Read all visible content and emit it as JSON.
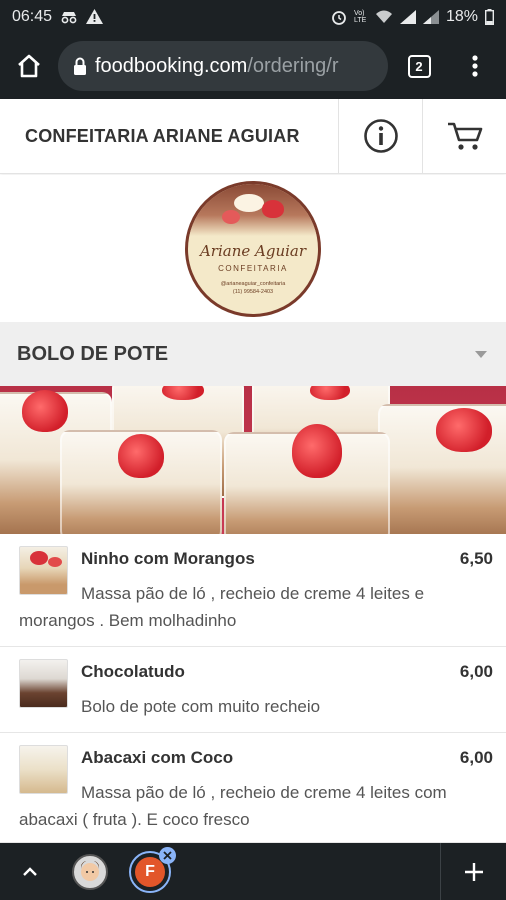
{
  "status_bar": {
    "time": "06:45",
    "battery": "18%",
    "network_label": "Vo) LTE"
  },
  "browser": {
    "url_domain": "foodbooking.com",
    "url_path": "/ordering/r",
    "tab_count": "2"
  },
  "store": {
    "name": "CONFEITARIA ARIANE AGUIAR",
    "logo": {
      "script_text": "Ariane Aguiar",
      "subtitle": "CONFEITARIA",
      "social_line1": "@arianeaguiar_confeitaria",
      "social_line2": "(11) 99584-2403"
    }
  },
  "section": {
    "title": "BOLO DE POTE"
  },
  "items": [
    {
      "name": "Ninho com Morangos",
      "price": "6,50",
      "description": "Massa pão de ló , recheio de creme 4 leites e morangos . Bem molhadinho"
    },
    {
      "name": "Chocolatudo",
      "price": "6,00",
      "description": "Bolo de pote com muito recheio"
    },
    {
      "name": "Abacaxi com Coco",
      "price": "6,00",
      "description": "Massa pão de ló , recheio de creme 4 leites com abacaxi ( fruta ). E coco fresco"
    }
  ],
  "bottom_bar": {
    "active_tab_letter": "F"
  },
  "colors": {
    "chrome_dark": "#1c2124",
    "url_field": "#33393d",
    "section_bg": "#efefef",
    "banner_red": "#c93a55",
    "accent_blue": "#8ab4f8"
  }
}
